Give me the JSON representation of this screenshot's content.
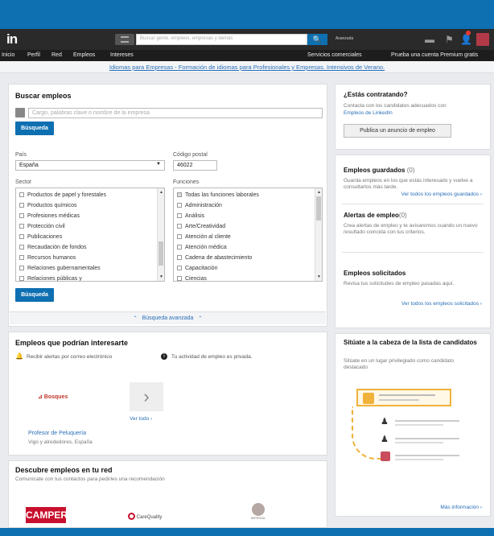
{
  "topbar": {
    "logo": "in",
    "search_placeholder": "Buscar gente, empleos, empresas y demás",
    "search_glyph": "🔍",
    "advanced": "Avanzada",
    "icon_messages": "▬",
    "icon_flag": "⚑",
    "icon_user": "👤",
    "notification_count": ""
  },
  "nav": {
    "items": [
      "Inicio",
      "Perfil",
      "Red",
      "Empleos",
      "Intereses"
    ],
    "right": [
      "Servicios comerciales",
      "Prueba una cuenta Premium gratis"
    ]
  },
  "banner": {
    "text": "Idiomas para Empresas - Formación de idiomas para Profesionales y Empresas. Intensivos de Verano."
  },
  "search_jobs": {
    "title": "Buscar empleos",
    "keyword_placeholder": "Cargo, palabras clave o nombre de la empresa",
    "search_button": "Búsqueda",
    "country_label": "País",
    "country_value": "España",
    "postal_label": "Código postal",
    "postal_value": "46022",
    "sector_label": "Sector",
    "sectors": [
      "Productos de papel y forestales",
      "Productos químicos",
      "Profesiones médicas",
      "Protección civil",
      "Publicaciones",
      "Recaudación de fondos",
      "Recursos humanos",
      "Relaciones gubernamentales",
      "Relaciones públicas y"
    ],
    "functions_label": "Funciones",
    "functions": [
      "Todas las funciones laborales",
      "Administración",
      "Análisis",
      "Arte/Creatividad",
      "Atención al cliente",
      "Atención médica",
      "Cadena de abastecimiento",
      "Capacitación",
      "Ciencias"
    ],
    "search_button_2": "Búsqueda",
    "advanced_toggle": "Búsqueda avanzada"
  },
  "interesting_jobs": {
    "title": "Empleos que podrían interesarte",
    "alerts_text": "Recibir alertas por correo electrónico",
    "privacy_text": "Tu actividad de empleo es privada.",
    "company_logo_text": "⊿ Bosques",
    "view_all": "Ver todo",
    "job_title": "Profesor de Peluquería",
    "job_location": "Vigo y alrededores, España"
  },
  "network_jobs": {
    "title": "Descubre empleos en tu red",
    "subtitle": "Comunícate con tus contactos para pedirles una recomendación",
    "logos": [
      "CAMPER",
      "CareQuality",
      "IMPERIAL"
    ]
  },
  "hiring": {
    "title": "¿Estás contratando?",
    "text": "Contacta con los candidatos adecuados con",
    "link": "Empleos de LinkedIn",
    "button": "Publica un anuncio de empleo"
  },
  "saved_jobs": {
    "title": "Empleos guardados",
    "count": "(0)",
    "text": "Guarda empleos en los que estás interesado y vuelve a consultarlos más tarde.",
    "link": "Ver todos los empleos guardados"
  },
  "job_alerts": {
    "title": "Alertas de empleo",
    "count": "(0)",
    "text": "Crea alertas de empleo y te avisaremos cuando un nuevo resultado coincida con tus criterios."
  },
  "applied_jobs": {
    "title": "Empleos solicitados",
    "text": "Revisa tus solicitudes de empleo pasadas aquí.",
    "link": "Ver todos los empleos solicitados"
  },
  "featured": {
    "title": "Sitúate a la cabeza de la lista de candidatos",
    "text": "Sitúate en un lugar privilegiado como candidato destacado",
    "link": "Más información"
  },
  "colors": {
    "brand": "#0e6fb1",
    "link": "#2a6fb8",
    "topbar": "#2a2a2a",
    "highlight": "#f0b23a"
  }
}
